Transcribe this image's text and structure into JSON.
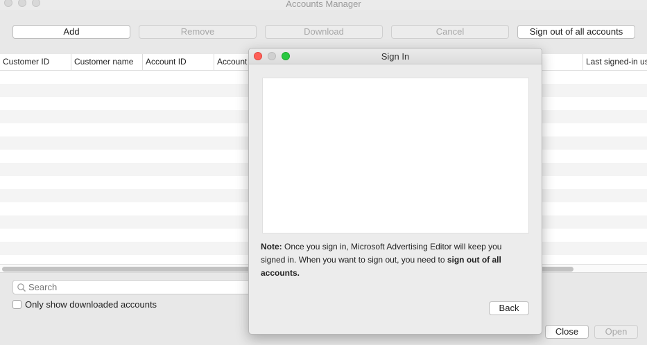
{
  "window": {
    "title": "Accounts Manager"
  },
  "toolbar": {
    "add": "Add",
    "remove": "Remove",
    "download": "Download",
    "cancel": "Cancel",
    "sign_out_all": "Sign out of all accounts"
  },
  "table": {
    "columns": [
      "Customer ID",
      "Customer name",
      "Account ID",
      "Account",
      "Last signed-in us"
    ],
    "rows": []
  },
  "search": {
    "placeholder": "Search",
    "value": ""
  },
  "filter": {
    "only_downloaded_label": "Only show downloaded accounts",
    "checked": false
  },
  "footer": {
    "close": "Close",
    "open": "Open"
  },
  "dialog": {
    "title": "Sign In",
    "note_label": "Note:",
    "note_text": " Once you sign in, Microsoft Advertising Editor will keep you signed in. When you want to sign out, you need to ",
    "note_bold": "sign out of all accounts.",
    "back": "Back"
  }
}
